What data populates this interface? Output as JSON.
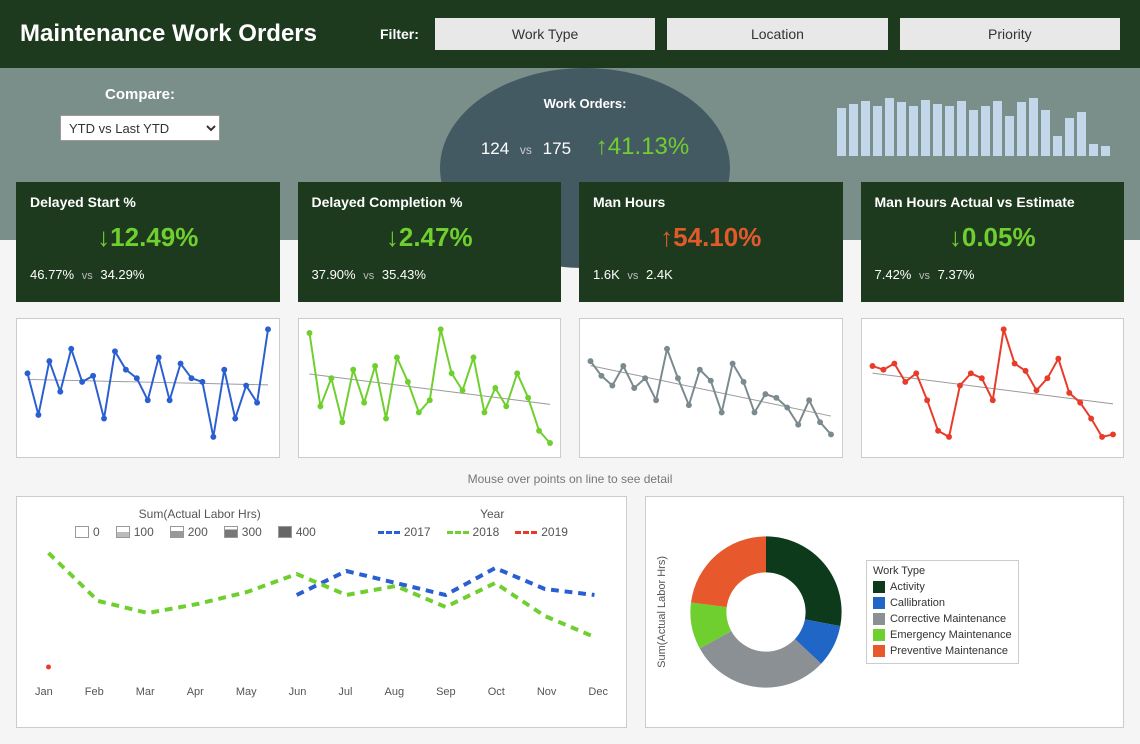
{
  "header": {
    "title": "Maintenance Work Orders",
    "filter_label": "Filter:",
    "filters": [
      "Work Type",
      "Location",
      "Priority"
    ]
  },
  "compare": {
    "label": "Compare:",
    "selected": "YTD vs Last YTD"
  },
  "work_orders": {
    "label": "Work Orders:",
    "a": "124",
    "vs": "vs",
    "b": "175",
    "delta": "↑41.13%",
    "sparkbars": [
      48,
      52,
      55,
      50,
      58,
      54,
      50,
      56,
      52,
      50,
      55,
      46,
      50,
      55,
      40,
      54,
      58,
      46,
      20,
      38,
      44,
      12,
      10
    ]
  },
  "kpis": [
    {
      "title": "Delayed Start %",
      "pct": "↓12.49%",
      "class": "green",
      "a": "46.77%",
      "b": "34.29%"
    },
    {
      "title": "Delayed Completion %",
      "pct": "↓2.47%",
      "class": "green",
      "a": "37.90%",
      "b": "35.43%"
    },
    {
      "title": "Man Hours",
      "pct": "↑54.10%",
      "class": "red",
      "a": "1.6K",
      "b": "2.4K"
    },
    {
      "title": "Man Hours Actual vs Estimate",
      "pct": "↓0.05%",
      "class": "green",
      "a": "7.42%",
      "b": "7.37%"
    }
  ],
  "sparklines": [
    {
      "color": "#2a5fd1",
      "data": [
        62,
        28,
        72,
        47,
        82,
        55,
        60,
        25,
        80,
        65,
        58,
        40,
        75,
        40,
        70,
        58,
        55,
        10,
        65,
        25,
        52,
        38,
        98
      ]
    },
    {
      "color": "#6fcf2e",
      "data": [
        95,
        35,
        58,
        22,
        65,
        38,
        68,
        25,
        75,
        55,
        30,
        40,
        98,
        62,
        48,
        75,
        30,
        50,
        35,
        62,
        42,
        15,
        5
      ]
    },
    {
      "color": "#7a8a8f",
      "data": [
        72,
        60,
        52,
        68,
        50,
        58,
        40,
        82,
        58,
        36,
        65,
        56,
        30,
        70,
        55,
        30,
        45,
        42,
        34,
        20,
        40,
        22,
        12
      ]
    },
    {
      "color": "#e83b2a",
      "data": [
        68,
        65,
        70,
        55,
        62,
        40,
        15,
        10,
        52,
        62,
        58,
        40,
        98,
        70,
        64,
        48,
        58,
        74,
        46,
        38,
        25,
        10,
        12
      ]
    }
  ],
  "hint": "Mouse over points on line to see detail",
  "bigchart": {
    "legend1_title": "Sum(Actual  Labor Hrs)",
    "legend1_items": [
      "0",
      "100",
      "200",
      "300",
      "400"
    ],
    "legend2_title": "Year",
    "legend2_items": [
      {
        "label": "2017",
        "color": "#2a5fd1"
      },
      {
        "label": "2018",
        "color": "#6fcf2e"
      },
      {
        "label": "2019",
        "color": "#e83b2a"
      }
    ],
    "months": [
      "Jan",
      "Feb",
      "Mar",
      "Apr",
      "May",
      "Jun",
      "Jul",
      "Aug",
      "Sep",
      "Oct",
      "Nov",
      "Dec"
    ]
  },
  "pie": {
    "ylabel": "Sum(Actual  Labor Hrs)",
    "legend_title": "Work Type",
    "items": [
      {
        "label": "Activity",
        "color": "#0d3a1a"
      },
      {
        "label": "Callibration",
        "color": "#1f66c7"
      },
      {
        "label": "Corrective Maintenance",
        "color": "#8a9094"
      },
      {
        "label": "Emergency Maintenance",
        "color": "#6fcf2e"
      },
      {
        "label": "Preventive Maintenance",
        "color": "#e8582d"
      }
    ]
  },
  "chart_data": [
    {
      "type": "bar",
      "title": "Work Orders spark bars",
      "values": [
        48,
        52,
        55,
        50,
        58,
        54,
        50,
        56,
        52,
        50,
        55,
        46,
        50,
        55,
        40,
        54,
        58,
        46,
        20,
        38,
        44,
        12,
        10
      ]
    },
    {
      "type": "line",
      "title": "Delayed Start % trend",
      "values": [
        62,
        28,
        72,
        47,
        82,
        55,
        60,
        25,
        80,
        65,
        58,
        40,
        75,
        40,
        70,
        58,
        55,
        10,
        65,
        25,
        52,
        38,
        98
      ],
      "ylim": [
        0,
        100
      ],
      "trend": "slightly down"
    },
    {
      "type": "line",
      "title": "Delayed Completion % trend",
      "values": [
        95,
        35,
        58,
        22,
        65,
        38,
        68,
        25,
        75,
        55,
        30,
        40,
        98,
        62,
        48,
        75,
        30,
        50,
        35,
        62,
        42,
        15,
        5
      ],
      "ylim": [
        0,
        100
      ],
      "trend": "down"
    },
    {
      "type": "line",
      "title": "Man Hours trend",
      "values": [
        72,
        60,
        52,
        68,
        50,
        58,
        40,
        82,
        58,
        36,
        65,
        56,
        30,
        70,
        55,
        30,
        45,
        42,
        34,
        20,
        40,
        22,
        12
      ],
      "ylim": [
        0,
        100
      ],
      "trend": "down"
    },
    {
      "type": "line",
      "title": "Man Hours Actual vs Estimate trend",
      "values": [
        68,
        65,
        70,
        55,
        62,
        40,
        15,
        10,
        52,
        62,
        58,
        40,
        98,
        70,
        64,
        48,
        58,
        74,
        46,
        38,
        25,
        10,
        12
      ],
      "ylim": [
        0,
        100
      ],
      "trend": "down"
    },
    {
      "type": "line",
      "title": "Sum(Actual Labor Hrs) by Month",
      "xlabel": "",
      "ylabel": "Sum(Actual Labor Hrs)",
      "categories": [
        "Jan",
        "Feb",
        "Mar",
        "Apr",
        "May",
        "Jun",
        "Jul",
        "Aug",
        "Sep",
        "Oct",
        "Nov",
        "Dec"
      ],
      "series": [
        {
          "name": "2017",
          "values": [
            null,
            null,
            null,
            null,
            null,
            260,
            340,
            300,
            260,
            350,
            280,
            260
          ]
        },
        {
          "name": "2018",
          "values": [
            400,
            240,
            200,
            230,
            270,
            330,
            260,
            290,
            220,
            300,
            190,
            120
          ]
        },
        {
          "name": "2019",
          "values": [
            20,
            null,
            null,
            null,
            null,
            null,
            null,
            null,
            null,
            null,
            null,
            null
          ]
        }
      ],
      "ylim": [
        0,
        400
      ],
      "size_legend": [
        0,
        100,
        200,
        300,
        400
      ]
    },
    {
      "type": "pie",
      "title": "Sum(Actual Labor Hrs) by Work Type",
      "categories": [
        "Activity",
        "Callibration",
        "Corrective Maintenance",
        "Emergency Maintenance",
        "Preventive Maintenance"
      ],
      "values": [
        28,
        9,
        30,
        10,
        23
      ],
      "colors": [
        "#0d3a1a",
        "#1f66c7",
        "#8a9094",
        "#6fcf2e",
        "#e8582d"
      ],
      "donut": true
    }
  ]
}
